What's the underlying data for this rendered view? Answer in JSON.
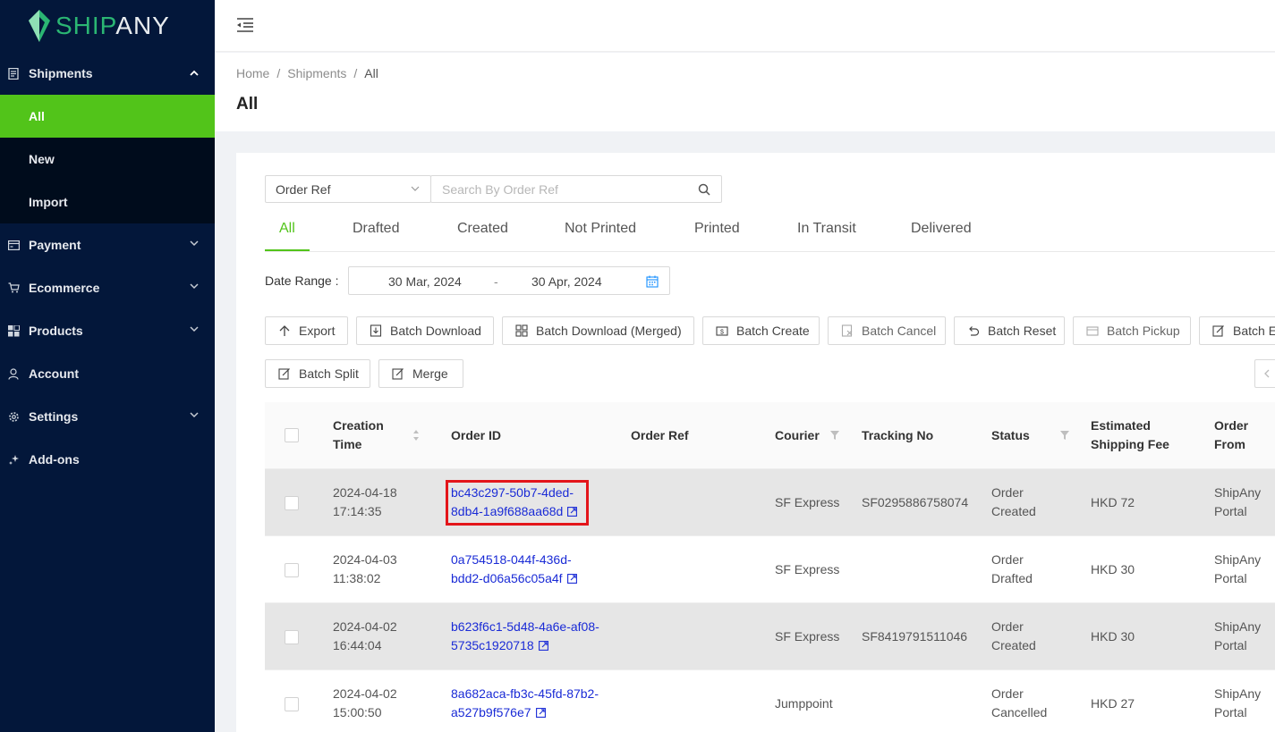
{
  "app": {
    "brand_ship": "SHIP",
    "brand_any": "ANY",
    "accent": "#52c41a",
    "sidebar_bg": "#03173a",
    "link_color": "#1a2bd6"
  },
  "sidebar": {
    "shipments": {
      "label": "Shipments",
      "icon": "document-icon",
      "expanded": true
    },
    "shipments_sub": [
      {
        "label": "All",
        "active": true
      },
      {
        "label": "New"
      },
      {
        "label": "Import"
      }
    ],
    "items": [
      {
        "label": "Payment",
        "icon": "wallet-icon"
      },
      {
        "label": "Ecommerce",
        "icon": "cart-icon"
      },
      {
        "label": "Products",
        "icon": "grid-icon"
      },
      {
        "label": "Account",
        "icon": "user-icon"
      },
      {
        "label": "Settings",
        "icon": "gear-icon"
      },
      {
        "label": "Add-ons",
        "icon": "sparkle-icon"
      }
    ]
  },
  "breadcrumb": {
    "home": "Home",
    "shipments": "Shipments",
    "current": "All",
    "sep": "/"
  },
  "page": {
    "title": "All"
  },
  "filter": {
    "select_value": "Order Ref",
    "search_placeholder": "Search By Order Ref"
  },
  "tabs": [
    "All",
    "Drafted",
    "Created",
    "Not Printed",
    "Printed",
    "In Transit",
    "Delivered"
  ],
  "date_range": {
    "label": "Date Range",
    "colon": ":",
    "start": "30 Mar, 2024",
    "separator": "-",
    "end": "30 Apr, 2024"
  },
  "actions": {
    "export": "Export",
    "batch_download": "Batch Download",
    "batch_download_merged": "Batch Download (Merged)",
    "batch_create": "Batch Create",
    "batch_cancel": "Batch Cancel",
    "batch_reset": "Batch Reset",
    "batch_pickup": "Batch Pickup",
    "batch_edit": "Batch Edit",
    "batch_split": "Batch Split",
    "merge": "Merge"
  },
  "table": {
    "headers": {
      "creation_time_1": "Creation",
      "creation_time_2": "Time",
      "order_id": "Order ID",
      "order_ref": "Order Ref",
      "courier": "Courier",
      "tracking_no": "Tracking No",
      "status": "Status",
      "fee_1": "Estimated",
      "fee_2": "Shipping Fee",
      "from_1": "Order",
      "from_2": "From"
    },
    "rows": [
      {
        "date": "2024-04-18",
        "time": "17:14:35",
        "id1": "bc43c297-50b7-4ded-",
        "id2": "8db4-1a9f688aa68d",
        "ref": "",
        "courier": "SF Express",
        "tracking": "SF0295886758074",
        "status1": "Order",
        "status2": "Created",
        "fee": "HKD 72",
        "from1": "ShipAny",
        "from2": "Portal"
      },
      {
        "date": "2024-04-03",
        "time": "11:38:02",
        "id1": "0a754518-044f-436d-",
        "id2": "bdd2-d06a56c05a4f",
        "ref": "",
        "courier": "SF Express",
        "tracking": "",
        "status1": "Order",
        "status2": "Drafted",
        "fee": "HKD 30",
        "from1": "ShipAny",
        "from2": "Portal"
      },
      {
        "date": "2024-04-02",
        "time": "16:44:04",
        "id1": "b623f6c1-5d48-4a6e-af08-",
        "id2": "5735c1920718",
        "ref": "",
        "courier": "SF Express",
        "tracking": "SF8419791511046",
        "status1": "Order",
        "status2": "Created",
        "fee": "HKD 30",
        "from1": "ShipAny",
        "from2": "Portal"
      },
      {
        "date": "2024-04-02",
        "time": "15:00:50",
        "id1": "8a682aca-fb3c-45fd-87b2-",
        "id2": "a527b9f576e7",
        "ref": "",
        "courier": "Jumppoint",
        "tracking": "",
        "status1": "Order",
        "status2": "Cancelled",
        "fee": "HKD 27",
        "from1": "ShipAny",
        "from2": "Portal"
      }
    ]
  }
}
